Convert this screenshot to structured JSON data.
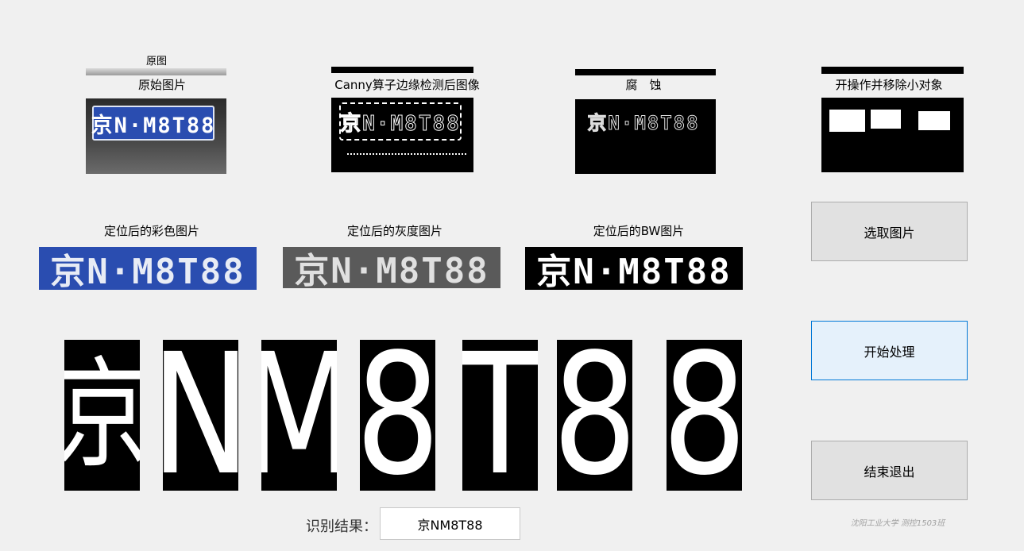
{
  "panels": {
    "original_top_label": "原图",
    "original_title": "原始图片",
    "canny_title": "Canny算子边缘检测后图像",
    "erode_title": "腐　蚀",
    "open_title": "开操作并移除小对象"
  },
  "plate": {
    "chars": [
      "京",
      "N",
      "M",
      "8",
      "T",
      "8",
      "8"
    ],
    "plate_string": "京N·M8T88",
    "color_title": "定位后的彩色图片",
    "gray_title": "定位后的灰度图片",
    "bw_title": "定位后的BW图片"
  },
  "buttons": {
    "select": "选取图片",
    "start": "开始处理",
    "exit": "结束退出"
  },
  "result": {
    "label": "识别结果：",
    "value": "京NM8T88"
  },
  "footer": "沈阳工业大学 测控1503班",
  "colors": {
    "background": "#f0f0f0",
    "plate_blue": "#2a4db0",
    "button_face": "#e1e1e1",
    "button_focus_border": "#0078d7"
  }
}
